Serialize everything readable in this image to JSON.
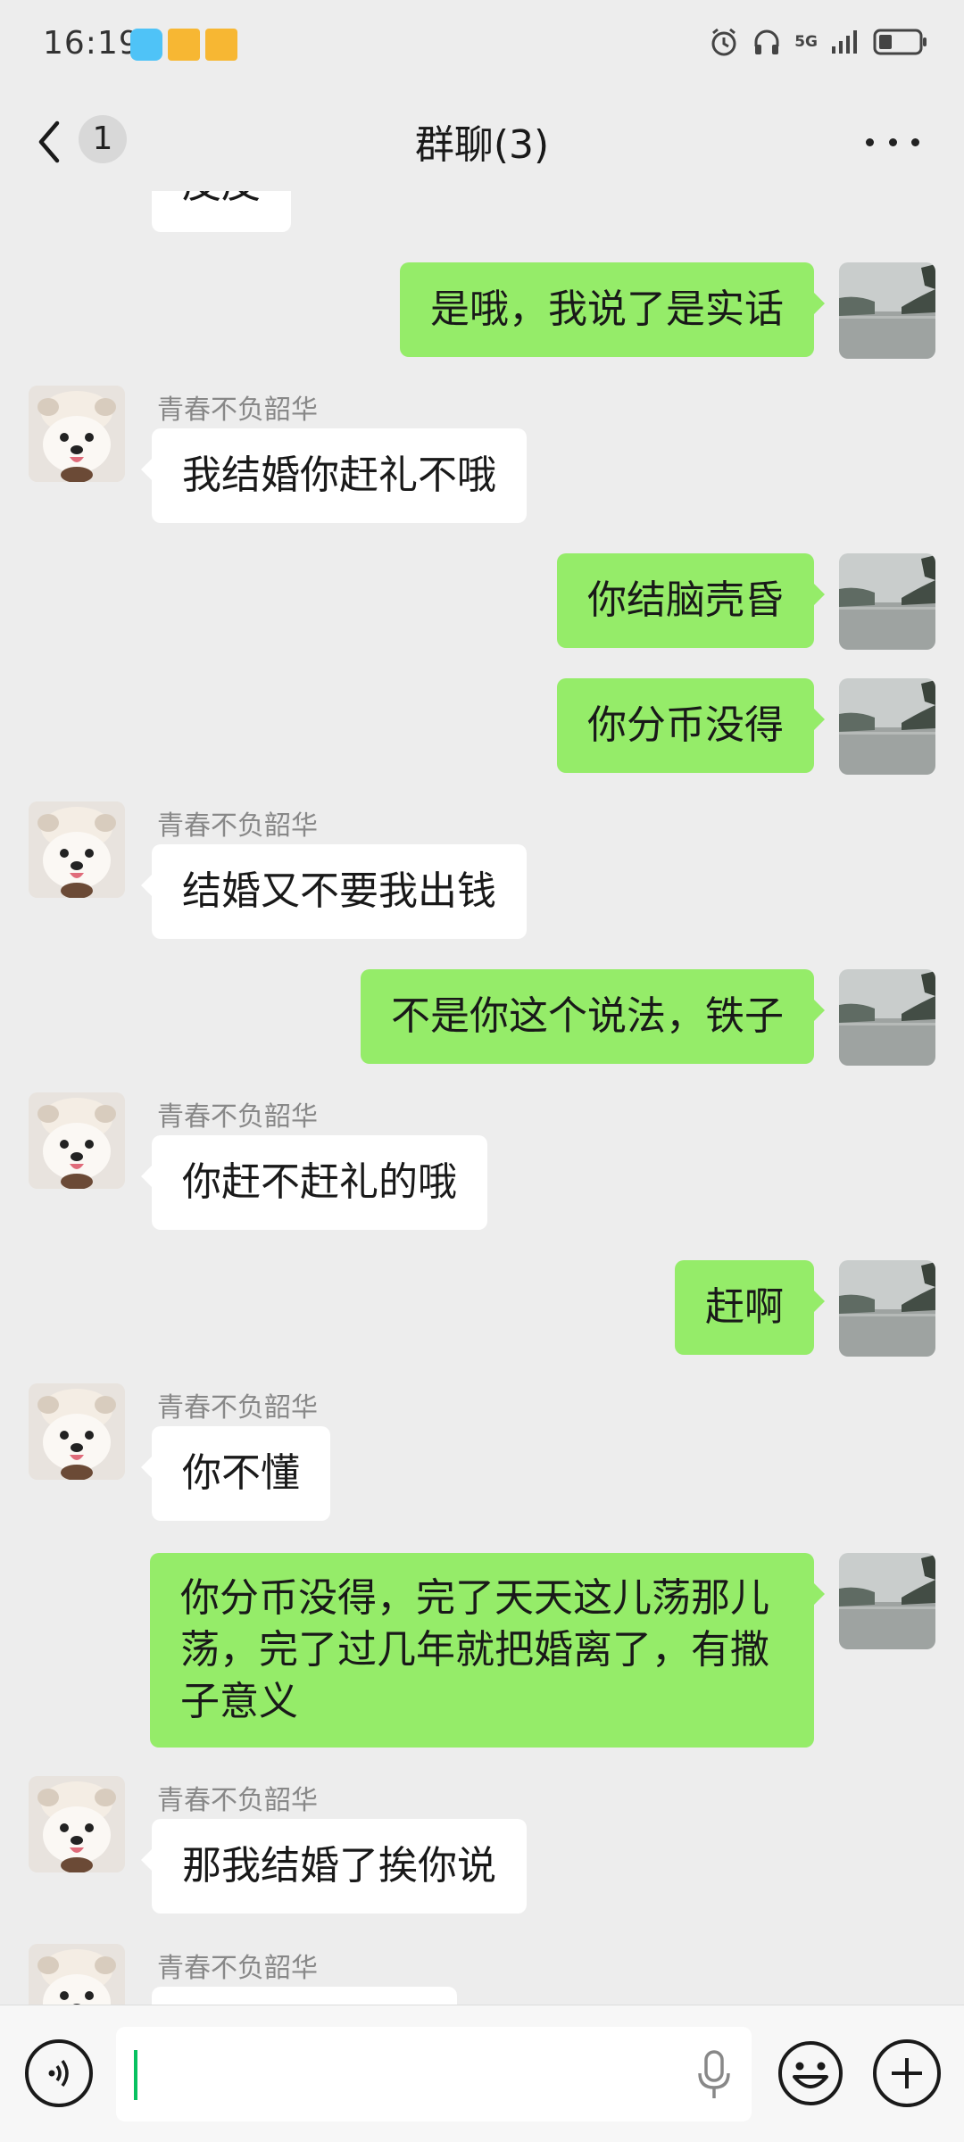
{
  "status_bar": {
    "time": "16:19",
    "network": "5G",
    "icons": [
      "book-icon",
      "folder-icon",
      "folder-icon",
      "alarm-icon",
      "headphones-icon",
      "signal-icon",
      "battery-icon"
    ]
  },
  "header": {
    "unread_count": "1",
    "title": "群聊(3)"
  },
  "messages": [
    {
      "side": "in",
      "sender": "",
      "text": "皮皮"
    },
    {
      "side": "out",
      "text": "是哦，我说了是实话"
    },
    {
      "side": "in",
      "sender": "青春不负韶华",
      "text": "我结婚你赶礼不哦"
    },
    {
      "side": "out",
      "text": "你结脑壳昏"
    },
    {
      "side": "out",
      "text": "你分币没得"
    },
    {
      "side": "in",
      "sender": "青春不负韶华",
      "text": "结婚又不要我出钱"
    },
    {
      "side": "out",
      "text": "不是你这个说法，铁子"
    },
    {
      "side": "in",
      "sender": "青春不负韶华",
      "text": "你赶不赶礼的哦"
    },
    {
      "side": "out",
      "text": "赶啊"
    },
    {
      "side": "in",
      "sender": "青春不负韶华",
      "text": "你不懂"
    },
    {
      "side": "out",
      "text": "你分币没得，完了天天这儿荡那儿荡，完了过几年就把婚离了，有撒子意义"
    },
    {
      "side": "in",
      "sender": "青春不负韶华",
      "text": "那我结婚了挨你说"
    },
    {
      "side": "in",
      "sender": "青春不负韶华",
      "text": ""
    }
  ],
  "input_bar": {
    "value": "",
    "icons": [
      "voice-icon",
      "mic-icon",
      "emoji-icon",
      "plus-icon"
    ]
  },
  "colors": {
    "background": "#ededed",
    "outgoing_bubble": "#95ec69",
    "incoming_bubble": "#ffffff",
    "cursor": "#07c160"
  }
}
